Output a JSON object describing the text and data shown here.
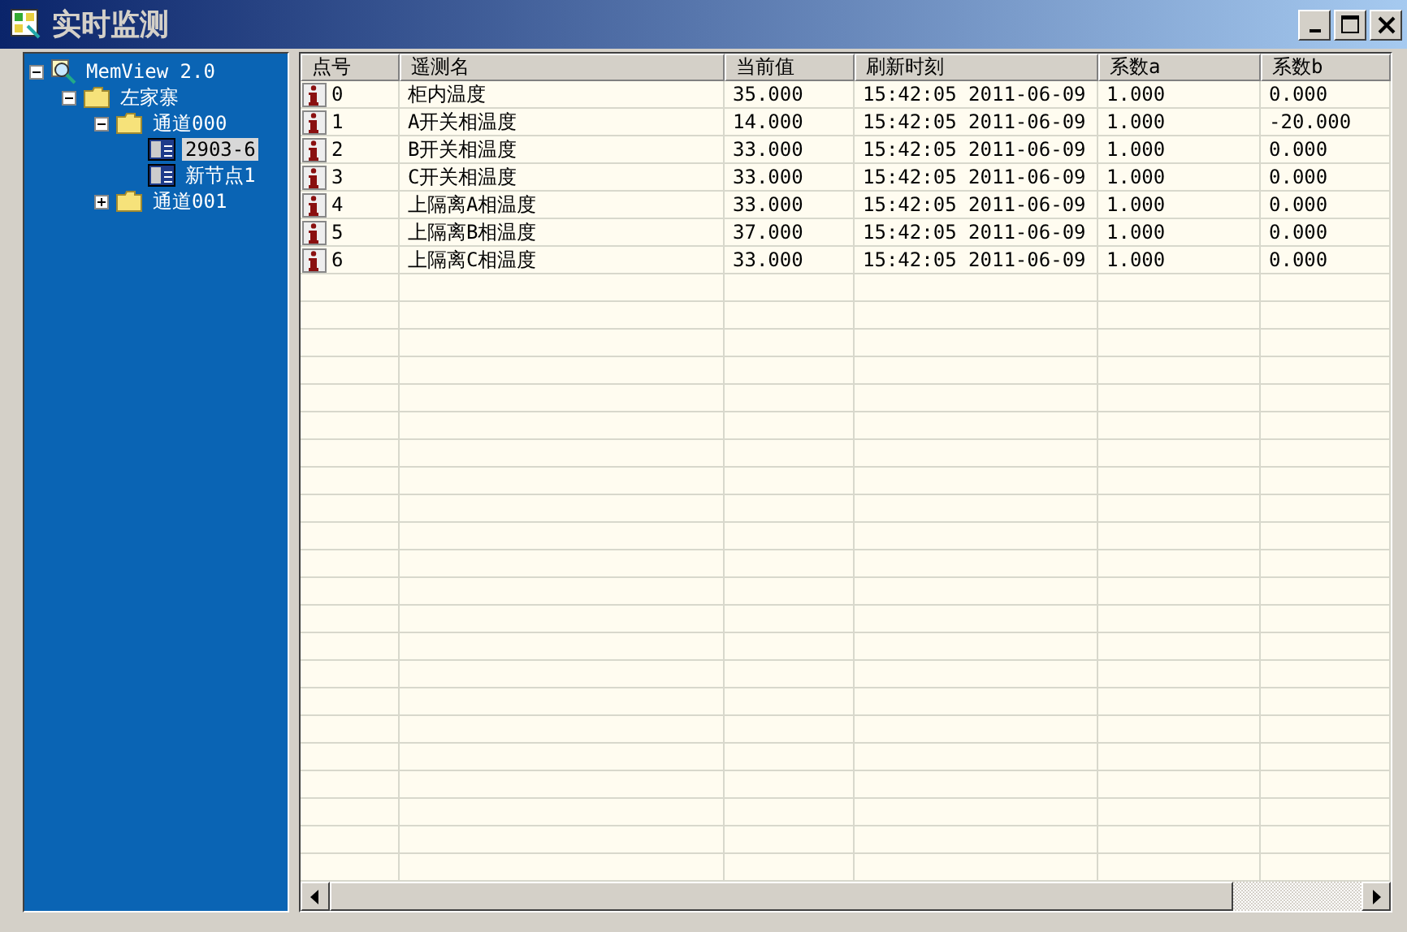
{
  "window": {
    "title": "实时监测"
  },
  "tree": [
    {
      "label": "MemView 2.0",
      "kind": "root",
      "expanded": true,
      "selected": false,
      "children": [
        {
          "label": "左家寨",
          "kind": "folder",
          "expanded": true,
          "selected": false,
          "children": [
            {
              "label": "通道000",
              "kind": "folder",
              "expanded": true,
              "selected": false,
              "children": [
                {
                  "label": "2903-6",
                  "kind": "point",
                  "selected": true
                },
                {
                  "label": "新节点1",
                  "kind": "point",
                  "selected": false
                }
              ]
            },
            {
              "label": "通道001",
              "kind": "folder",
              "expanded": false,
              "selected": false
            }
          ]
        }
      ]
    }
  ],
  "table": {
    "columns": [
      "点号",
      "遥测名",
      "当前值",
      "刷新时刻",
      "系数a",
      "系数b"
    ],
    "rows": [
      [
        "0",
        "柜内温度",
        "35.000",
        "15:42:05 2011-06-09",
        "1.000",
        "0.000"
      ],
      [
        "1",
        "A开关相温度",
        "14.000",
        "15:42:05 2011-06-09",
        "1.000",
        "-20.000"
      ],
      [
        "2",
        "B开关相温度",
        "33.000",
        "15:42:05 2011-06-09",
        "1.000",
        "0.000"
      ],
      [
        "3",
        "C开关相温度",
        "33.000",
        "15:42:05 2011-06-09",
        "1.000",
        "0.000"
      ],
      [
        "4",
        "上隔离A相温度",
        "33.000",
        "15:42:05 2011-06-09",
        "1.000",
        "0.000"
      ],
      [
        "5",
        "上隔离B相温度",
        "37.000",
        "15:42:05 2011-06-09",
        "1.000",
        "0.000"
      ],
      [
        "6",
        "上隔离C相温度",
        "33.000",
        "15:42:05 2011-06-09",
        "1.000",
        "0.000"
      ]
    ]
  }
}
